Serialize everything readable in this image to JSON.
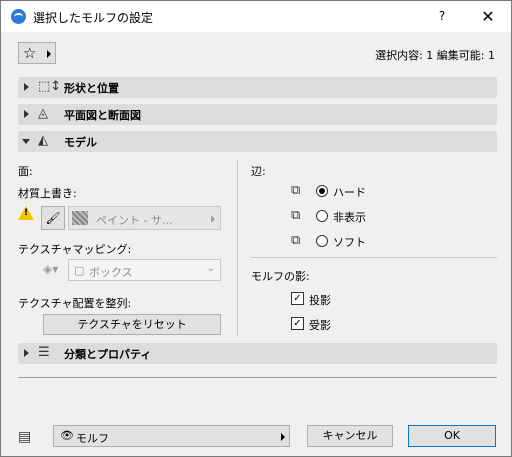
{
  "window": {
    "title": "選択したモルフの設定",
    "help_label": "?",
    "close_label": "✕"
  },
  "toolbar": {
    "favorites_icon": "star-icon",
    "selection_info": "選択内容: 1 編集可能: 1"
  },
  "sections": {
    "shape": {
      "label": "形状と位置",
      "expanded": false,
      "icon": "shape-position-icon"
    },
    "plan": {
      "label": "平面図と断面図",
      "expanded": false,
      "icon": "plan-section-icon"
    },
    "model": {
      "label": "モデル",
      "expanded": true,
      "icon": "model-icon"
    },
    "classification": {
      "label": "分類とプロパティ",
      "expanded": false,
      "icon": "properties-icon"
    }
  },
  "model": {
    "face_label": "面:",
    "material_override_label": "材質上書き:",
    "material_value": "ペイント - サ...",
    "texture_mapping_label": "テクスチャマッピング:",
    "texture_mapping_value": "ボックス",
    "texture_align_label": "テクスチャ配置を整列:",
    "reset_texture_label": "テクスチャをリセット",
    "edge_label": "辺:",
    "edge_options": [
      {
        "label": "ハード",
        "selected": true
      },
      {
        "label": "非表示",
        "selected": false
      },
      {
        "label": "ソフト",
        "selected": false
      }
    ],
    "shadow_label": "モルフの影:",
    "cast_shadow_label": "投影",
    "cast_shadow_checked": true,
    "receive_shadow_label": "受影",
    "receive_shadow_checked": true
  },
  "footer": {
    "layer_value": "モルフ",
    "cancel_label": "キャンセル",
    "ok_label": "OK"
  },
  "colors": {
    "warning": "#f2c500",
    "ok_border": "#0078d7"
  }
}
